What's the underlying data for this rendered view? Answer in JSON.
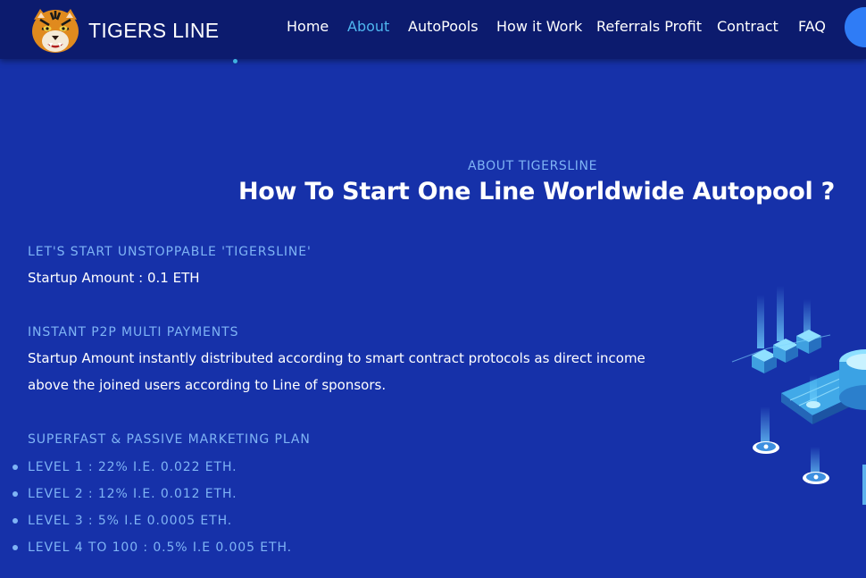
{
  "brand": {
    "name": "TIGERS LINE",
    "logo_icon": "tiger-head-icon"
  },
  "nav": {
    "items": [
      {
        "label": "Home",
        "active": false
      },
      {
        "label": "About",
        "active": true
      },
      {
        "label": "AutoPools",
        "active": false
      },
      {
        "label": "How it Work",
        "active": false
      },
      {
        "label": "Referrals Profit",
        "active": false
      },
      {
        "label": "Contract",
        "active": false
      },
      {
        "label": "FAQ",
        "active": false
      }
    ]
  },
  "about": {
    "eyebrow": "ABOUT TIGERSLINE",
    "headline": "How To Start One Line Worldwide Autopool ?",
    "sections": [
      {
        "heading": "LET'S START UNSTOPPABLE 'TIGERSLINE'",
        "lines": [
          "Startup Amount : 0.1 ETH"
        ]
      },
      {
        "heading": "INSTANT P2P MULTI PAYMENTS",
        "lines": [
          "Startup Amount instantly distributed according to smart contract protocols as direct income",
          "above the joined users according to Line of sponsors."
        ]
      },
      {
        "heading": "SUPERFAST & PASSIVE MARKETING PLAN",
        "lines": []
      }
    ],
    "levels": [
      "LEVEL 1 : 22% I.E. 0.022 ETH.",
      "LEVEL 2 : 12% I.E. 0.012 ETH.",
      "LEVEL 3 : 5% I.E 0.0005 ETH.",
      "LEVEL 4 TO 100 : 0.5% I.E 0.005 ETH."
    ]
  },
  "colors": {
    "background": "#1631a9",
    "navbar": "#0c1b6e",
    "accent_text": "#7fb4f5",
    "active_link": "#4fb6ef",
    "button": "#2f7cf6"
  },
  "illustration": {
    "icon": "blockchain-isometric-illustration"
  }
}
